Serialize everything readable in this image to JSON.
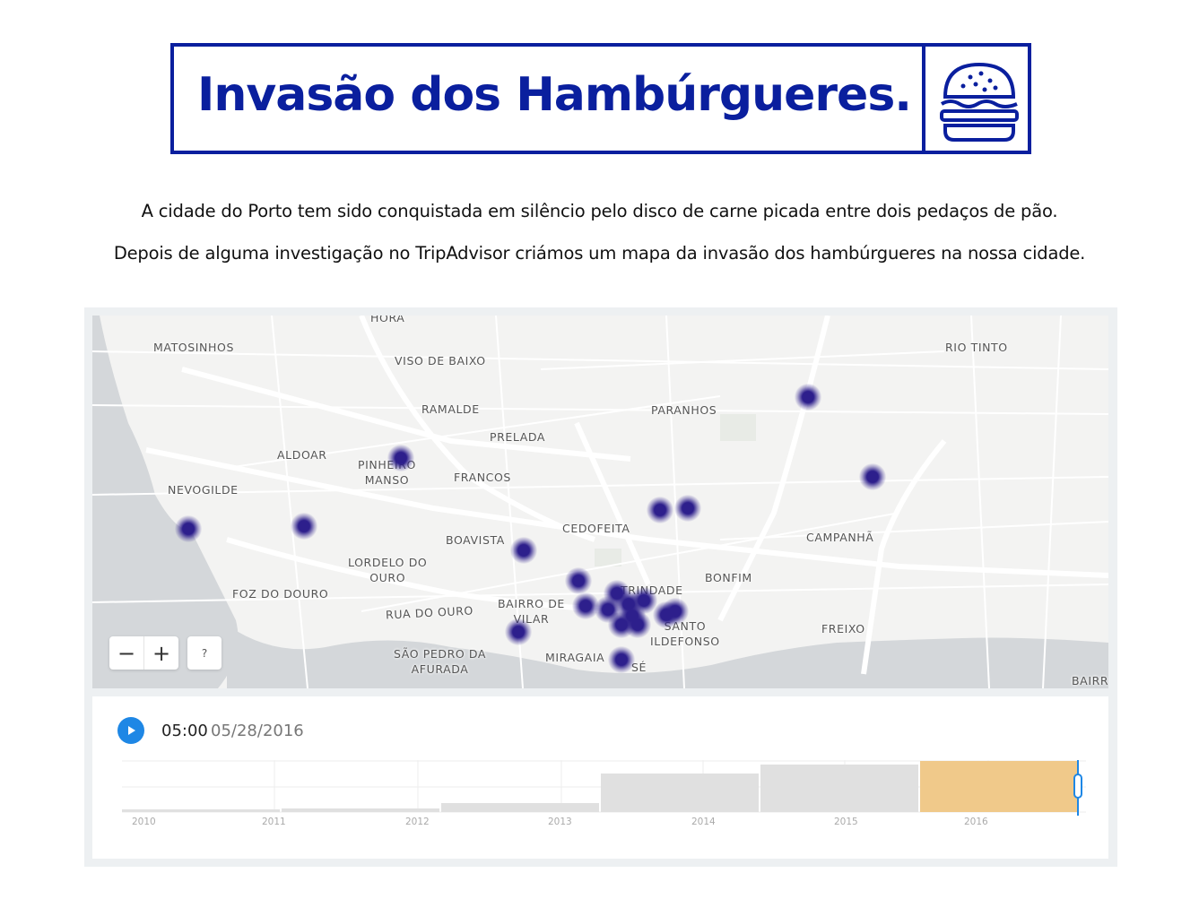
{
  "banner": {
    "title": "Invasão dos Hambúrgueres.",
    "color": "#0a1f9e",
    "icon": "burger-icon"
  },
  "intro": {
    "line1": "A cidade do Porto tem sido conquistada em silêncio pelo disco de carne picada entre dois pedaços de pão.",
    "line2": "Depois de alguma investigação no TripAdvisor criámos um mapa da invasão dos hambúrgueres na nossa cidade."
  },
  "map": {
    "places": {
      "hora": "HORA",
      "matosinhos": "MATOSINHOS",
      "viso": "VISO DE BAIXO",
      "rio_tinto": "RIO TINTO",
      "ramalde": "RAMALDE",
      "paranhos": "PARANHOS",
      "prelada": "PRELADA",
      "aldoar": "ALDOAR",
      "pinheiro_manso": "PINHEIRO\nMANSO",
      "francos": "FRANCOS",
      "nevogilde": "NEVOGILDE",
      "cedofeita": "CEDOFEITA",
      "campanha": "CAMPANHÃ",
      "boavista": "BOAVISTA",
      "lordelo": "LORDELO DO\nOURO",
      "bonfim": "BONFIM",
      "trindade": "TRINDADE",
      "foz": "FOZ DO DOURO",
      "bairro_vilar": "BAIRRO DE\nVILAR",
      "rua_ouro": "RUA DO OURO",
      "santo_ildefonso": "SANTO\nILDEFONSO",
      "freixo": "FREIXO",
      "sao_pedro": "SÃO PEDRO DA\nAFURADA",
      "miragaia": "MIRAGAIA",
      "se": "SÉ",
      "bairr": "BAIRR"
    },
    "dot_color": "#2d1f8c",
    "controls": {
      "zoom_out": "−",
      "zoom_in": "+",
      "help": "?"
    }
  },
  "timeline": {
    "time": "05:00",
    "date": "05/28/2016",
    "years": [
      "2010",
      "2011",
      "2012",
      "2013",
      "2014",
      "2015",
      "2016"
    ],
    "bar_color": "#e0e0e0",
    "highlight_color": "#f0c98a",
    "handle_color": "#1e87e5"
  }
}
